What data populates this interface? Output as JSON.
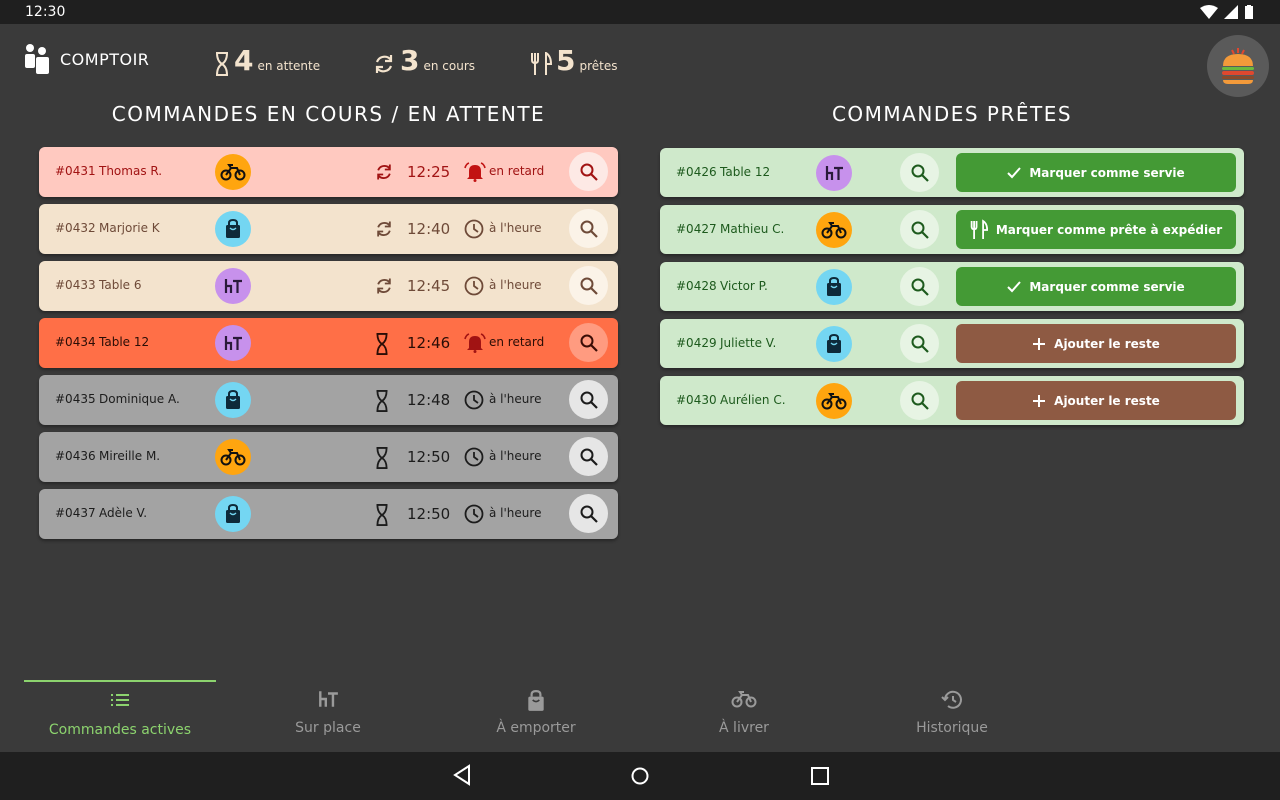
{
  "status_bar": {
    "time": "12:30"
  },
  "header": {
    "station_label": "COMPTOIR",
    "counters": [
      {
        "icon": "hourglass-icon",
        "count": "4",
        "label": "en attente"
      },
      {
        "icon": "refresh-icon",
        "count": "3",
        "label": "en cours"
      },
      {
        "icon": "utensils-icon",
        "count": "5",
        "label": "prêtes"
      }
    ],
    "avatar_icon": "burger-logo-icon"
  },
  "sections": {
    "left_title": "COMMANDES EN COURS / EN ATTENTE",
    "right_title": "COMMANDES PRÊTES"
  },
  "orders": [
    {
      "id": "#0431",
      "name": "Thomas R.",
      "type": "delivery",
      "status": "in-progress",
      "time": "12:25",
      "timing": "en retard",
      "theme": "late-pink"
    },
    {
      "id": "#0432",
      "name": "Marjorie K",
      "type": "takeaway",
      "status": "in-progress",
      "time": "12:40",
      "timing": "à l'heure",
      "theme": "beige"
    },
    {
      "id": "#0433",
      "name": "Table 6",
      "type": "dine-in",
      "status": "in-progress",
      "time": "12:45",
      "timing": "à l'heure",
      "theme": "beige"
    },
    {
      "id": "#0434",
      "name": "Table 12",
      "type": "dine-in",
      "status": "waiting",
      "time": "12:46",
      "timing": "en retard",
      "theme": "late-orange"
    },
    {
      "id": "#0435",
      "name": "Dominique A.",
      "type": "takeaway",
      "status": "waiting",
      "time": "12:48",
      "timing": "à l'heure",
      "theme": "grey"
    },
    {
      "id": "#0436",
      "name": "Mireille M.",
      "type": "delivery",
      "status": "waiting",
      "time": "12:50",
      "timing": "à l'heure",
      "theme": "grey"
    },
    {
      "id": "#0437",
      "name": "Adèle V.",
      "type": "takeaway",
      "status": "waiting",
      "time": "12:50",
      "timing": "à l'heure",
      "theme": "grey"
    }
  ],
  "ready_orders": [
    {
      "id": "#0426",
      "name": "Table 12",
      "type": "dine-in",
      "action": "Marquer comme servie",
      "action_icon": "check-icon",
      "action_color": "#449a35"
    },
    {
      "id": "#0427",
      "name": "Mathieu C.",
      "type": "delivery",
      "action": "Marquer comme prête à expédier",
      "action_icon": "utensils-icon",
      "action_color": "#449a35"
    },
    {
      "id": "#0428",
      "name": "Victor P.",
      "type": "takeaway",
      "action": "Marquer comme servie",
      "action_icon": "check-icon",
      "action_color": "#449a35"
    },
    {
      "id": "#0429",
      "name": "Juliette V.",
      "type": "takeaway",
      "action": "Ajouter le reste",
      "action_icon": "plus-icon",
      "action_color": "#8e5a43"
    },
    {
      "id": "#0430",
      "name": "Aurélien C.",
      "type": "delivery",
      "action": "Ajouter le reste",
      "action_icon": "plus-icon",
      "action_color": "#8e5a43"
    }
  ],
  "bottom_nav": [
    {
      "label": "Commandes actives",
      "icon": "list-icon",
      "active": true
    },
    {
      "label": "Sur place",
      "icon": "table-icon",
      "active": false
    },
    {
      "label": "À emporter",
      "icon": "bag-icon",
      "active": false
    },
    {
      "label": "À livrer",
      "icon": "bike-icon",
      "active": false
    },
    {
      "label": "Historique",
      "icon": "history-icon",
      "active": false
    }
  ],
  "colors": {
    "background": "#3a3a3a",
    "accent_green": "#8cd36e",
    "late_pink": "#ffc9c0",
    "late_orange": "#ff6f47",
    "beige": "#f3e3cd",
    "grey": "#a3a3a3",
    "ready_bg": "#cfe9cb",
    "delivery_badge": "#ffa50f",
    "takeaway_badge": "#74d6f2",
    "dinein_badge": "#c791ec"
  }
}
